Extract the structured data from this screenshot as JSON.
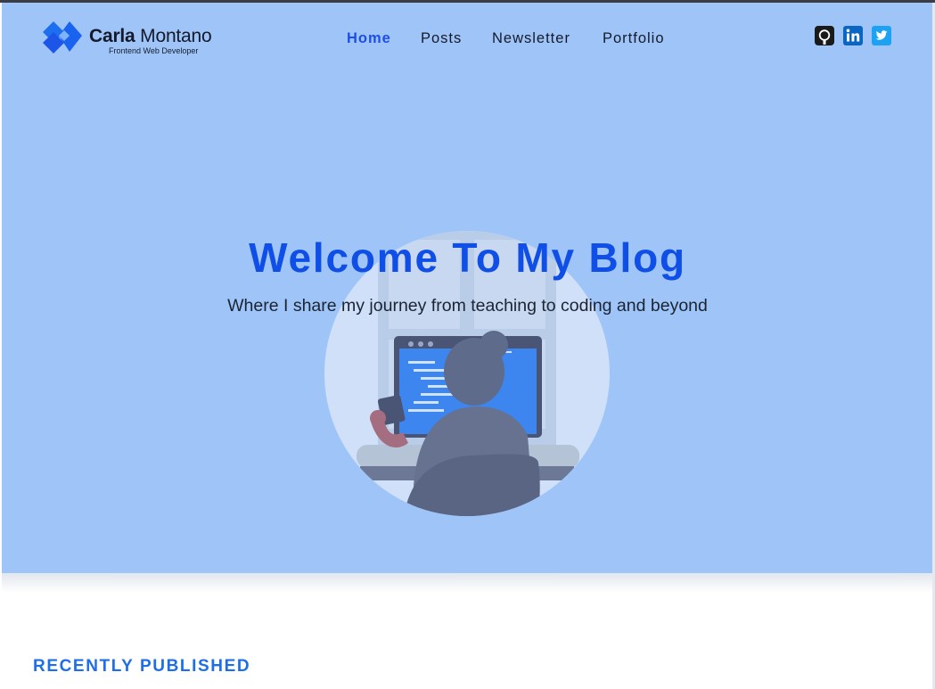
{
  "header": {
    "logo": {
      "first_name": "Carla",
      "last_name": "Montano",
      "tagline": "Frontend Web Developer"
    },
    "nav": [
      {
        "label": "Home",
        "active": true
      },
      {
        "label": "Posts",
        "active": false
      },
      {
        "label": "Newsletter",
        "active": false
      },
      {
        "label": "Portfolio",
        "active": false
      }
    ],
    "social": [
      {
        "icon": "github-icon",
        "color": "#1a1a1a"
      },
      {
        "icon": "linkedin-icon",
        "color": "#0a66c2"
      },
      {
        "icon": "twitter-icon",
        "color": "#1da1f2"
      }
    ]
  },
  "hero": {
    "title": "Welcome To My Blog",
    "subtitle": "Where I share my journey from teaching to coding and beyond",
    "background": "#9fc5f8",
    "title_color": "#0f4fe8"
  },
  "main": {
    "section_title": "RECENTLY PUBLISHED",
    "section_title_color": "#1d6ee8"
  }
}
